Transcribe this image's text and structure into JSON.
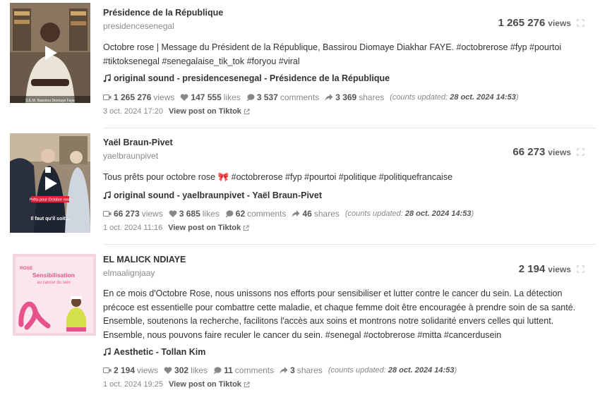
{
  "posts": [
    {
      "author": "Présidence de la République",
      "handle": "presidencesenegal",
      "views_count": "1 265 276",
      "views_label": "views",
      "caption": "Octobre rose | Message du Président de la République, Bassirou Diomaye Diakhar FAYE. #octobrerose #fyp #pourtoi #tiktoksenegal #senegalaise_tik_tok #foryou #viral",
      "sound": "original sound - presidencesenegal - Présidence de la République",
      "stats": {
        "views": "1 265 276",
        "views_label": "views",
        "likes": "147 555",
        "likes_label": "likes",
        "comments": "3 537",
        "comments_label": "comments",
        "shares": "3 369",
        "shares_label": "shares",
        "updated_prefix": "(counts updated:",
        "updated_date": "28 oct. 2024 14:53",
        "updated_suffix": ")"
      },
      "date": "3 oct. 2024 17:20",
      "link_label": "View post on Tiktok",
      "thumb_caption": "S.E.M. Bassirou Diomaye Faye"
    },
    {
      "author": "Yaël Braun-Pivet",
      "handle": "yaelbraunpivet",
      "views_count": "66 273",
      "views_label": "views",
      "caption": "Tous prêts pour octobre rose 🎀 #octobrerose #fyp #pourtoi #politique #politiquefrancaise",
      "sound": "original sound - yaelbraunpivet - Yaël Braun-Pivet",
      "stats": {
        "views": "66 273",
        "views_label": "views",
        "likes": "3 685",
        "likes_label": "likes",
        "comments": "62",
        "comments_label": "comments",
        "shares": "46",
        "shares_label": "shares",
        "updated_prefix": "(counts updated:",
        "updated_date": "28 oct. 2024 14:53",
        "updated_suffix": ")"
      },
      "date": "1 oct. 2024 11:16",
      "link_label": "View post on Tiktok",
      "thumb_tag": "Prêts pour Octobre rose",
      "thumb_caption": "Il faut qu'il soit..."
    },
    {
      "author": "EL MALICK NDIAYE",
      "handle": "elmaalignjaay",
      "views_count": "2 194",
      "views_label": "views",
      "caption": "En ce mois d'Octobre Rose, nous unissons nos efforts pour sensibiliser et lutter contre le cancer du sein. La détection précoce est essentielle pour combattre cette maladie, et chaque femme doit être encouragée à prendre soin de sa santé. Ensemble, soutenons la recherche, facilitons l'accès aux soins et montrons notre solidarité envers celles qui luttent. Ensemble, nous pouvons faire reculer le cancer du sein. #senegal #octobrerose #mitta #cancerdusein",
      "sound": "Aesthetic - Tollan Kim",
      "stats": {
        "views": "2 194",
        "views_label": "views",
        "likes": "302",
        "likes_label": "likes",
        "comments": "11",
        "comments_label": "comments",
        "shares": "3",
        "shares_label": "shares",
        "updated_prefix": "(counts updated:",
        "updated_date": "28 oct. 2024 14:53",
        "updated_suffix": ")"
      },
      "date": "1 oct. 2024 19:25",
      "link_label": "View post on Tiktok",
      "thumb_tag": "ROSE",
      "thumb_title": "Sensibilisation",
      "thumb_subtitle": "au cancer du sein"
    }
  ],
  "colors": {
    "text": "#333333",
    "muted": "#888888",
    "pink": "#e7528a",
    "divider": "#e6e6e6"
  }
}
